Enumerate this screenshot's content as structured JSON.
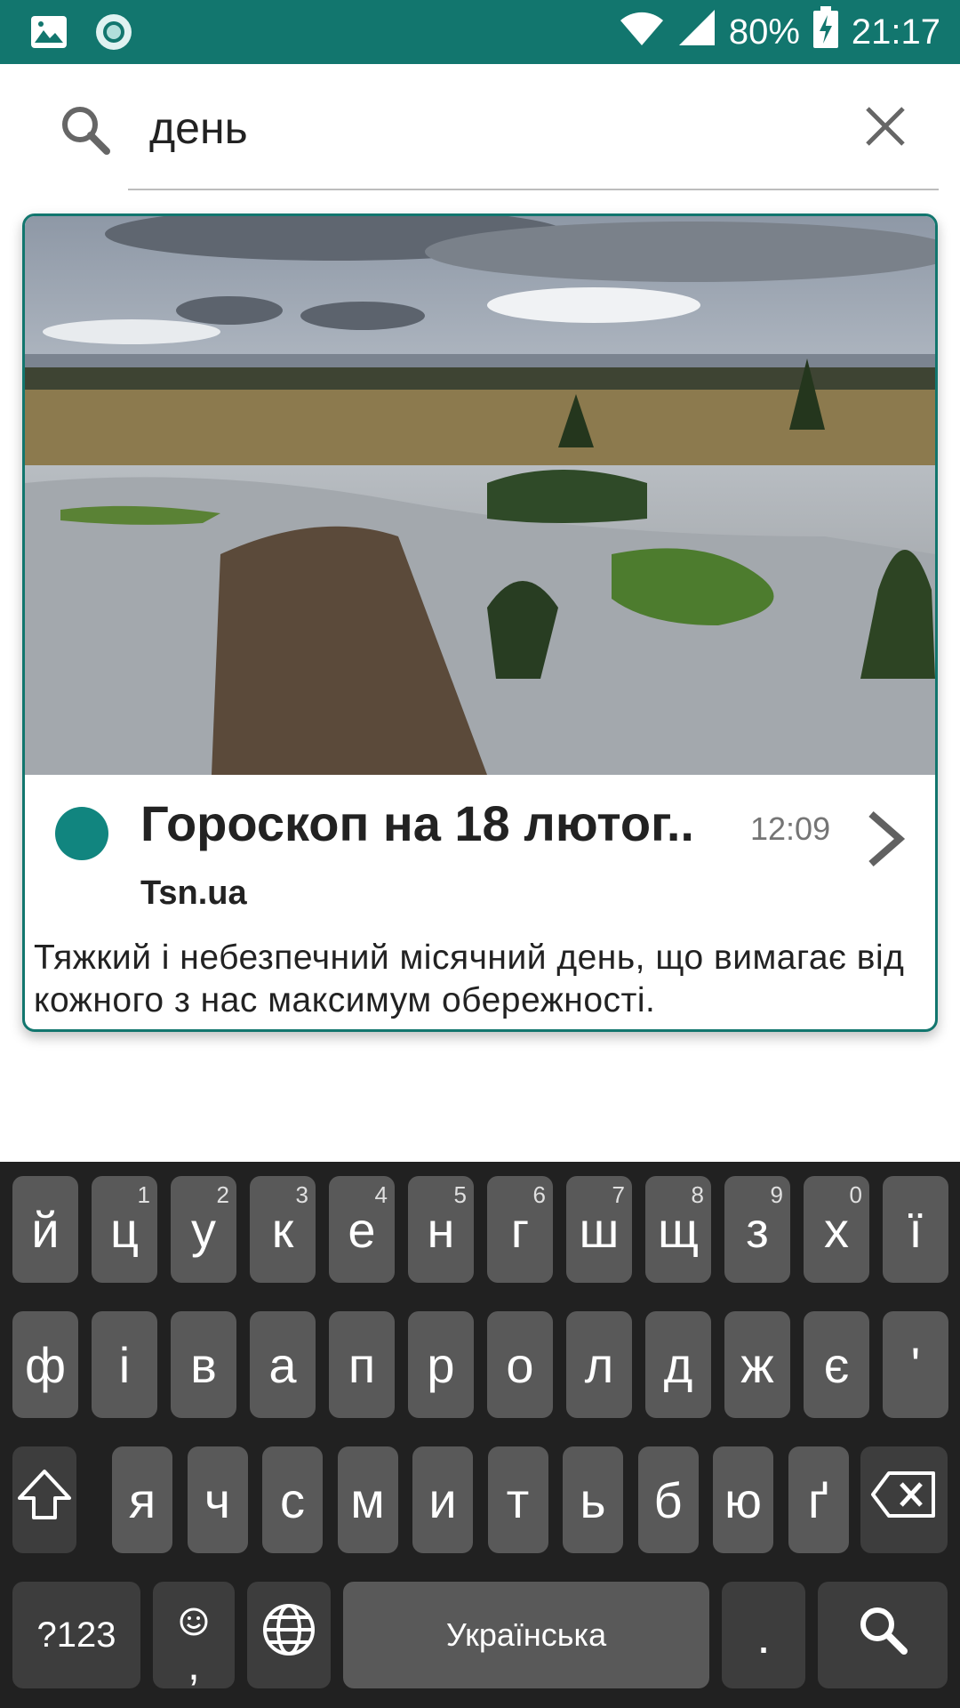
{
  "status_bar": {
    "left_icons": [
      "image-icon",
      "record-icon"
    ],
    "battery": "80%",
    "time": "21:17",
    "right_icons": [
      "wifi-icon",
      "signal-icon",
      "battery-charging-icon"
    ]
  },
  "search": {
    "query": "день",
    "icon": "search-icon",
    "clear_icon": "close-icon"
  },
  "card": {
    "title": "Гороскоп на 18 лютог..",
    "time": "12:09",
    "source": "Tsn.ua",
    "description": "Тяжкий і небезпечний місячний день, що вимагає від кожного з нас максимум обережності.",
    "accent_color": "#12766e",
    "dot_color": "#11857f"
  },
  "keyboard": {
    "row1": [
      {
        "label": "й",
        "hint": ""
      },
      {
        "label": "ц",
        "hint": "1"
      },
      {
        "label": "у",
        "hint": "2"
      },
      {
        "label": "к",
        "hint": "3"
      },
      {
        "label": "е",
        "hint": "4"
      },
      {
        "label": "н",
        "hint": "5"
      },
      {
        "label": "г",
        "hint": "6"
      },
      {
        "label": "ш",
        "hint": "7"
      },
      {
        "label": "щ",
        "hint": "8"
      },
      {
        "label": "з",
        "hint": "9"
      },
      {
        "label": "х",
        "hint": "0"
      },
      {
        "label": "ї",
        "hint": ""
      }
    ],
    "row2": [
      "ф",
      "і",
      "в",
      "а",
      "п",
      "р",
      "о",
      "л",
      "д",
      "ж",
      "є",
      "'"
    ],
    "row3": [
      "я",
      "ч",
      "с",
      "м",
      "и",
      "т",
      "ь",
      "б",
      "ю",
      "ґ"
    ],
    "symbols_label": "?123",
    "emoji_comma": ",",
    "space_label": "Українська",
    "period": ".",
    "shift_icon": "shift-icon",
    "backspace_icon": "backspace-icon",
    "globe_icon": "globe-icon",
    "emoji_icon": "emoji-icon",
    "action_icon": "search-icon"
  }
}
